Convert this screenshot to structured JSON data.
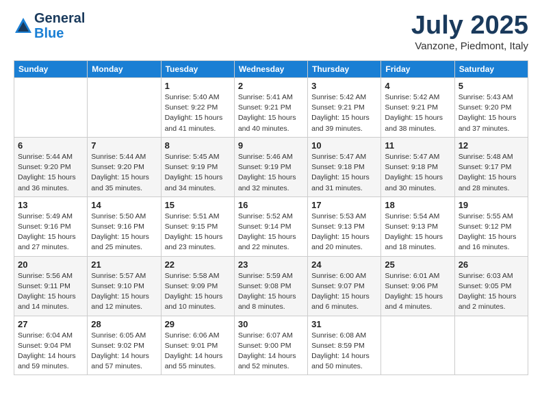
{
  "header": {
    "logo_general": "General",
    "logo_blue": "Blue",
    "month_title": "July 2025",
    "subtitle": "Vanzone, Piedmont, Italy"
  },
  "days_of_week": [
    "Sunday",
    "Monday",
    "Tuesday",
    "Wednesday",
    "Thursday",
    "Friday",
    "Saturday"
  ],
  "weeks": [
    [
      {
        "day": "",
        "detail": ""
      },
      {
        "day": "",
        "detail": ""
      },
      {
        "day": "1",
        "detail": "Sunrise: 5:40 AM\nSunset: 9:22 PM\nDaylight: 15 hours\nand 41 minutes."
      },
      {
        "day": "2",
        "detail": "Sunrise: 5:41 AM\nSunset: 9:21 PM\nDaylight: 15 hours\nand 40 minutes."
      },
      {
        "day": "3",
        "detail": "Sunrise: 5:42 AM\nSunset: 9:21 PM\nDaylight: 15 hours\nand 39 minutes."
      },
      {
        "day": "4",
        "detail": "Sunrise: 5:42 AM\nSunset: 9:21 PM\nDaylight: 15 hours\nand 38 minutes."
      },
      {
        "day": "5",
        "detail": "Sunrise: 5:43 AM\nSunset: 9:20 PM\nDaylight: 15 hours\nand 37 minutes."
      }
    ],
    [
      {
        "day": "6",
        "detail": "Sunrise: 5:44 AM\nSunset: 9:20 PM\nDaylight: 15 hours\nand 36 minutes."
      },
      {
        "day": "7",
        "detail": "Sunrise: 5:44 AM\nSunset: 9:20 PM\nDaylight: 15 hours\nand 35 minutes."
      },
      {
        "day": "8",
        "detail": "Sunrise: 5:45 AM\nSunset: 9:19 PM\nDaylight: 15 hours\nand 34 minutes."
      },
      {
        "day": "9",
        "detail": "Sunrise: 5:46 AM\nSunset: 9:19 PM\nDaylight: 15 hours\nand 32 minutes."
      },
      {
        "day": "10",
        "detail": "Sunrise: 5:47 AM\nSunset: 9:18 PM\nDaylight: 15 hours\nand 31 minutes."
      },
      {
        "day": "11",
        "detail": "Sunrise: 5:47 AM\nSunset: 9:18 PM\nDaylight: 15 hours\nand 30 minutes."
      },
      {
        "day": "12",
        "detail": "Sunrise: 5:48 AM\nSunset: 9:17 PM\nDaylight: 15 hours\nand 28 minutes."
      }
    ],
    [
      {
        "day": "13",
        "detail": "Sunrise: 5:49 AM\nSunset: 9:16 PM\nDaylight: 15 hours\nand 27 minutes."
      },
      {
        "day": "14",
        "detail": "Sunrise: 5:50 AM\nSunset: 9:16 PM\nDaylight: 15 hours\nand 25 minutes."
      },
      {
        "day": "15",
        "detail": "Sunrise: 5:51 AM\nSunset: 9:15 PM\nDaylight: 15 hours\nand 23 minutes."
      },
      {
        "day": "16",
        "detail": "Sunrise: 5:52 AM\nSunset: 9:14 PM\nDaylight: 15 hours\nand 22 minutes."
      },
      {
        "day": "17",
        "detail": "Sunrise: 5:53 AM\nSunset: 9:13 PM\nDaylight: 15 hours\nand 20 minutes."
      },
      {
        "day": "18",
        "detail": "Sunrise: 5:54 AM\nSunset: 9:13 PM\nDaylight: 15 hours\nand 18 minutes."
      },
      {
        "day": "19",
        "detail": "Sunrise: 5:55 AM\nSunset: 9:12 PM\nDaylight: 15 hours\nand 16 minutes."
      }
    ],
    [
      {
        "day": "20",
        "detail": "Sunrise: 5:56 AM\nSunset: 9:11 PM\nDaylight: 15 hours\nand 14 minutes."
      },
      {
        "day": "21",
        "detail": "Sunrise: 5:57 AM\nSunset: 9:10 PM\nDaylight: 15 hours\nand 12 minutes."
      },
      {
        "day": "22",
        "detail": "Sunrise: 5:58 AM\nSunset: 9:09 PM\nDaylight: 15 hours\nand 10 minutes."
      },
      {
        "day": "23",
        "detail": "Sunrise: 5:59 AM\nSunset: 9:08 PM\nDaylight: 15 hours\nand 8 minutes."
      },
      {
        "day": "24",
        "detail": "Sunrise: 6:00 AM\nSunset: 9:07 PM\nDaylight: 15 hours\nand 6 minutes."
      },
      {
        "day": "25",
        "detail": "Sunrise: 6:01 AM\nSunset: 9:06 PM\nDaylight: 15 hours\nand 4 minutes."
      },
      {
        "day": "26",
        "detail": "Sunrise: 6:03 AM\nSunset: 9:05 PM\nDaylight: 15 hours\nand 2 minutes."
      }
    ],
    [
      {
        "day": "27",
        "detail": "Sunrise: 6:04 AM\nSunset: 9:04 PM\nDaylight: 14 hours\nand 59 minutes."
      },
      {
        "day": "28",
        "detail": "Sunrise: 6:05 AM\nSunset: 9:02 PM\nDaylight: 14 hours\nand 57 minutes."
      },
      {
        "day": "29",
        "detail": "Sunrise: 6:06 AM\nSunset: 9:01 PM\nDaylight: 14 hours\nand 55 minutes."
      },
      {
        "day": "30",
        "detail": "Sunrise: 6:07 AM\nSunset: 9:00 PM\nDaylight: 14 hours\nand 52 minutes."
      },
      {
        "day": "31",
        "detail": "Sunrise: 6:08 AM\nSunset: 8:59 PM\nDaylight: 14 hours\nand 50 minutes."
      },
      {
        "day": "",
        "detail": ""
      },
      {
        "day": "",
        "detail": ""
      }
    ]
  ]
}
